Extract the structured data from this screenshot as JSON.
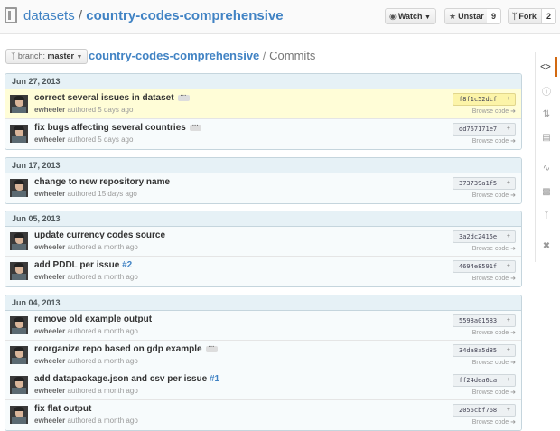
{
  "header": {
    "owner": "datasets",
    "separator": "/",
    "repo": "country-codes-comprehensive",
    "watch_label": "Watch",
    "unstar_label": "Unstar",
    "star_count": "9",
    "fork_label": "Fork",
    "fork_count": "2"
  },
  "subheader": {
    "branch_prefix": "branch:",
    "branch_name": "master",
    "repo": "country-codes-comprehensive",
    "separator": "/",
    "current": "Commits"
  },
  "browse_label": "Browse code",
  "groups": [
    {
      "date": "Jun 27, 2013",
      "commits": [
        {
          "message": "correct several issues in dataset",
          "issue": "",
          "author": "ewheeler",
          "time": "authored 5 days ago",
          "sha": "f8f1c52dcf",
          "highlight": true,
          "has_more": true
        },
        {
          "message": "fix bugs affecting several countries",
          "issue": "",
          "author": "ewheeler",
          "time": "authored 5 days ago",
          "sha": "dd767171e7",
          "highlight": false,
          "has_more": true
        }
      ]
    },
    {
      "date": "Jun 17, 2013",
      "commits": [
        {
          "message": "change to new repository name",
          "issue": "",
          "author": "ewheeler",
          "time": "authored 15 days ago",
          "sha": "373739a1f5",
          "highlight": false,
          "has_more": false
        }
      ]
    },
    {
      "date": "Jun 05, 2013",
      "commits": [
        {
          "message": "update currency codes source",
          "issue": "",
          "author": "ewheeler",
          "time": "authored a month ago",
          "sha": "3a2dc2415e",
          "highlight": false,
          "has_more": false
        },
        {
          "message": "add PDDL per issue",
          "issue": "#2",
          "author": "ewheeler",
          "time": "authored a month ago",
          "sha": "4694e8591f",
          "highlight": false,
          "has_more": false
        }
      ]
    },
    {
      "date": "Jun 04, 2013",
      "commits": [
        {
          "message": "remove old example output",
          "issue": "",
          "author": "ewheeler",
          "time": "authored a month ago",
          "sha": "5598a01583",
          "highlight": false,
          "has_more": false
        },
        {
          "message": "reorganize repo based on gdp example",
          "issue": "",
          "author": "ewheeler",
          "time": "authored a month ago",
          "sha": "34da8a5d85",
          "highlight": false,
          "has_more": true
        },
        {
          "message": "add datapackage.json and csv per issue",
          "issue": "#1",
          "author": "ewheeler",
          "time": "authored a month ago",
          "sha": "ff24dea6ca",
          "highlight": false,
          "has_more": false
        },
        {
          "message": "fix flat output",
          "issue": "",
          "author": "ewheeler",
          "time": "authored a month ago",
          "sha": "2056cbf768",
          "highlight": false,
          "has_more": false
        }
      ]
    }
  ],
  "nav_icons": [
    "code-icon",
    "issues-icon",
    "pull-requests-icon",
    "wiki-icon",
    "pulse-icon",
    "graphs-icon",
    "network-icon",
    "settings-icon"
  ],
  "colors": {
    "link": "#4183c4",
    "highlight": "#fffdd7",
    "group_header": "#e6f1f6",
    "active_nav": "#d26911"
  }
}
